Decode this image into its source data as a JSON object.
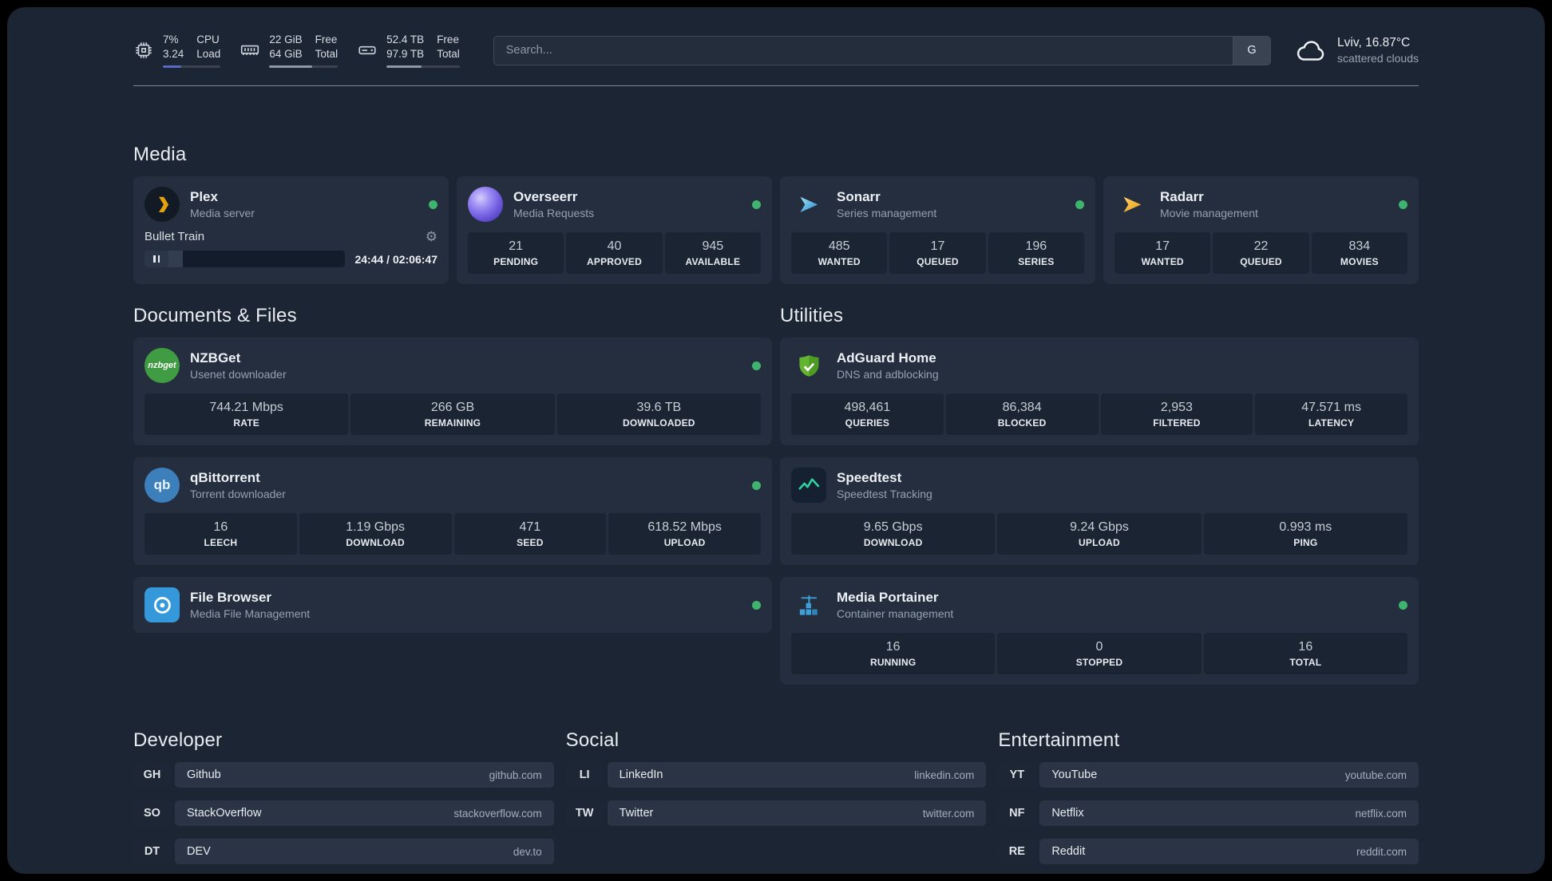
{
  "colors": {
    "status_online": "#3fb46e",
    "cpu_bar": "#5a67c4",
    "mem_bar": "#8e98a9",
    "disk_bar": "#8e98a9",
    "player_fill": "#323e50"
  },
  "topbar": {
    "cpu": {
      "v1": "7%",
      "v2": "3.24",
      "l1": "CPU",
      "l2": "Load",
      "bar_pct": 32
    },
    "mem": {
      "v1": "22 GiB",
      "v2": "64 GiB",
      "l1": "Free",
      "l2": "Total",
      "bar_pct": 62
    },
    "disk": {
      "v1": "52.4 TB",
      "v2": "97.9 TB",
      "l1": "Free",
      "l2": "Total",
      "bar_pct": 48
    },
    "search": {
      "placeholder": "Search...",
      "provider": "G"
    },
    "weather": {
      "location": "Lviv, 16.87°C",
      "condition": "scattered clouds"
    }
  },
  "sections": {
    "media": {
      "title": "Media",
      "plex": {
        "name": "Plex",
        "subtitle": "Media server",
        "status": "online",
        "player": {
          "title": "Bullet Train",
          "time": "24:44 / 02:06:47",
          "progress_pct": 19
        }
      },
      "overseerr": {
        "name": "Overseerr",
        "subtitle": "Media Requests",
        "status": "online",
        "stats": [
          {
            "value": "21",
            "label": "PENDING"
          },
          {
            "value": "40",
            "label": "APPROVED"
          },
          {
            "value": "945",
            "label": "AVAILABLE"
          }
        ]
      },
      "sonarr": {
        "name": "Sonarr",
        "subtitle": "Series management",
        "status": "online",
        "stats": [
          {
            "value": "485",
            "label": "WANTED"
          },
          {
            "value": "17",
            "label": "QUEUED"
          },
          {
            "value": "196",
            "label": "SERIES"
          }
        ]
      },
      "radarr": {
        "name": "Radarr",
        "subtitle": "Movie management",
        "status": "online",
        "stats": [
          {
            "value": "17",
            "label": "WANTED"
          },
          {
            "value": "22",
            "label": "QUEUED"
          },
          {
            "value": "834",
            "label": "MOVIES"
          }
        ]
      }
    },
    "documents": {
      "title": "Documents & Files",
      "nzbget": {
        "name": "NZBGet",
        "subtitle": "Usenet downloader",
        "status": "online",
        "stats": [
          {
            "value": "744.21 Mbps",
            "label": "RATE"
          },
          {
            "value": "266 GB",
            "label": "REMAINING"
          },
          {
            "value": "39.6 TB",
            "label": "DOWNLOADED"
          }
        ]
      },
      "qbittorrent": {
        "name": "qBittorrent",
        "subtitle": "Torrent downloader",
        "status": "online",
        "stats": [
          {
            "value": "16",
            "label": "LEECH"
          },
          {
            "value": "1.19 Gbps",
            "label": "DOWNLOAD"
          },
          {
            "value": "471",
            "label": "SEED"
          },
          {
            "value": "618.52 Mbps",
            "label": "UPLOAD"
          }
        ]
      },
      "filebrowser": {
        "name": "File Browser",
        "subtitle": "Media File Management",
        "status": "online"
      }
    },
    "utilities": {
      "title": "Utilities",
      "adguard": {
        "name": "AdGuard Home",
        "subtitle": "DNS and adblocking",
        "stats": [
          {
            "value": "498,461",
            "label": "QUERIES"
          },
          {
            "value": "86,384",
            "label": "BLOCKED"
          },
          {
            "value": "2,953",
            "label": "FILTERED"
          },
          {
            "value": "47.571 ms",
            "label": "LATENCY"
          }
        ]
      },
      "speedtest": {
        "name": "Speedtest",
        "subtitle": "Speedtest Tracking",
        "stats": [
          {
            "value": "9.65 Gbps",
            "label": "DOWNLOAD"
          },
          {
            "value": "9.24 Gbps",
            "label": "UPLOAD"
          },
          {
            "value": "0.993 ms",
            "label": "PING"
          }
        ]
      },
      "portainer": {
        "name": "Media Portainer",
        "subtitle": "Container management",
        "status": "online",
        "stats": [
          {
            "value": "16",
            "label": "RUNNING"
          },
          {
            "value": "0",
            "label": "STOPPED"
          },
          {
            "value": "16",
            "label": "TOTAL"
          }
        ]
      }
    }
  },
  "bookmarks": {
    "developer": {
      "title": "Developer",
      "items": [
        {
          "abbr": "GH",
          "name": "Github",
          "url": "github.com"
        },
        {
          "abbr": "SO",
          "name": "StackOverflow",
          "url": "stackoverflow.com"
        },
        {
          "abbr": "DT",
          "name": "DEV",
          "url": "dev.to"
        }
      ]
    },
    "social": {
      "title": "Social",
      "items": [
        {
          "abbr": "LI",
          "name": "LinkedIn",
          "url": "linkedin.com"
        },
        {
          "abbr": "TW",
          "name": "Twitter",
          "url": "twitter.com"
        }
      ]
    },
    "entertainment": {
      "title": "Entertainment",
      "items": [
        {
          "abbr": "YT",
          "name": "YouTube",
          "url": "youtube.com"
        },
        {
          "abbr": "NF",
          "name": "Netflix",
          "url": "netflix.com"
        },
        {
          "abbr": "RE",
          "name": "Reddit",
          "url": "reddit.com"
        }
      ]
    }
  }
}
